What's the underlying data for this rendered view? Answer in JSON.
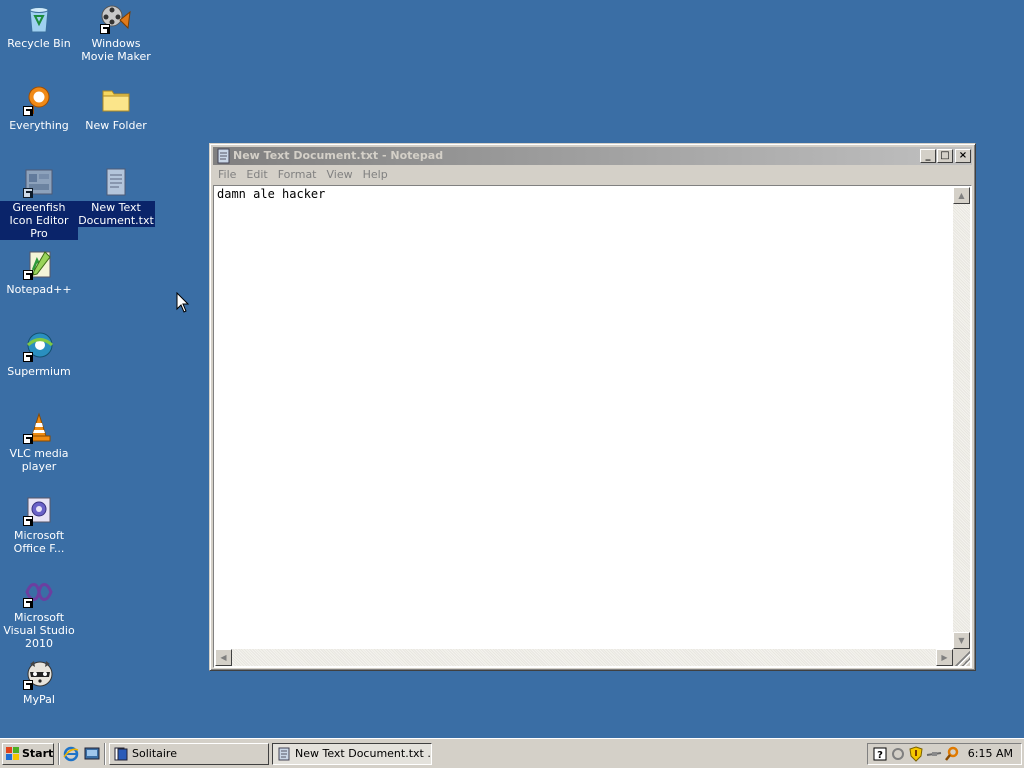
{
  "desktop": {
    "background_color": "#3a6ea5",
    "icons": [
      {
        "label": "Recycle Bin",
        "icon": "recycle-bin-icon"
      },
      {
        "label": "Windows Movie Maker",
        "icon": "movie-maker-icon"
      },
      {
        "label": "Everything",
        "icon": "everything-search-icon"
      },
      {
        "label": "New Folder",
        "icon": "folder-icon"
      },
      {
        "label": "Greenfish Icon Editor Pro",
        "icon": "greenfish-icon"
      },
      {
        "label": "New Text Document.txt",
        "icon": "text-document-icon"
      },
      {
        "label": "Notepad++",
        "icon": "notepad-plus-plus-icon"
      },
      {
        "label": "Supermium",
        "icon": "supermium-browser-icon"
      },
      {
        "label": "VLC media player",
        "icon": "vlc-cone-icon"
      },
      {
        "label": "Microsoft Office F...",
        "icon": "office-icon"
      },
      {
        "label": "Microsoft Visual Studio 2010",
        "icon": "visual-studio-icon"
      },
      {
        "label": "MyPal",
        "icon": "mypal-raccoon-icon"
      }
    ]
  },
  "notepad": {
    "title": "New Text Document.txt - Notepad",
    "menu": [
      "File",
      "Edit",
      "Format",
      "View",
      "Help"
    ],
    "content": "damn ale hacker",
    "buttons": {
      "minimize": "_",
      "maximize": "□",
      "close": "×"
    }
  },
  "taskbar": {
    "start_label": "Start",
    "tasks": [
      {
        "label": "Solitaire",
        "active": false
      },
      {
        "label": "New Text Document.txt ...",
        "active": true
      }
    ],
    "clock": "6:15 AM"
  }
}
